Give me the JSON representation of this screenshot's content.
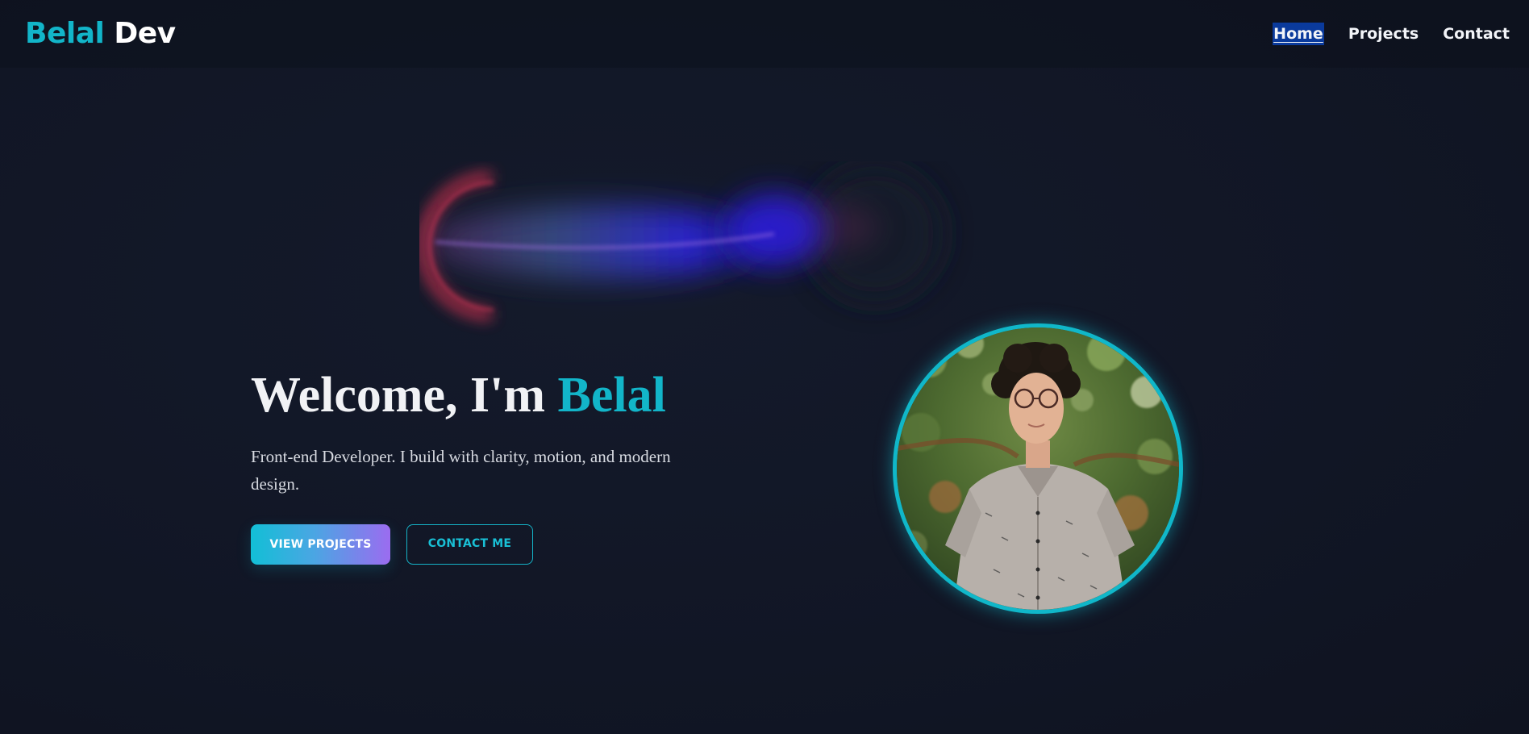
{
  "header": {
    "logo_first": "Belal",
    "logo_second": "Dev",
    "nav": [
      {
        "label": "Home",
        "active": true
      },
      {
        "label": "Projects",
        "active": false
      },
      {
        "label": "Contact",
        "active": false
      }
    ]
  },
  "hero": {
    "title_prefix": "Welcome, I'm",
    "title_name": "Belal",
    "subtitle": "Front-end Developer. I build with clarity, motion, and modern design.",
    "primary_button": "VIEW PROJECTS",
    "secondary_button": "CONTACT ME"
  },
  "colors": {
    "accent": "#12b5c9",
    "background": "#111625",
    "nav_active_bg": "#0a3a9c",
    "button_gradient_start": "#12bfd6",
    "button_gradient_end": "#9b6cf0"
  },
  "icons": {
    "comet": "comet-decoration",
    "avatar": "profile-photo"
  }
}
